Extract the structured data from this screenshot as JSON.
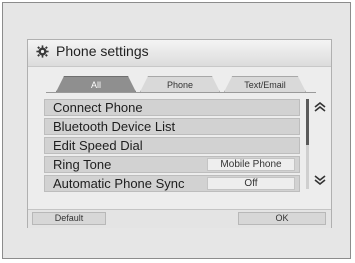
{
  "header": {
    "title": "Phone settings",
    "icon": "gear-icon"
  },
  "tabs": [
    {
      "label": "All",
      "active": true
    },
    {
      "label": "Phone",
      "active": false
    },
    {
      "label": "Text/Email",
      "active": false
    }
  ],
  "items": [
    {
      "label": "Connect Phone",
      "value": ""
    },
    {
      "label": "Bluetooth Device List",
      "value": ""
    },
    {
      "label": "Edit Speed Dial",
      "value": ""
    },
    {
      "label": "Ring Tone",
      "value": "Mobile Phone"
    },
    {
      "label": "Automatic Phone Sync",
      "value": "Off"
    }
  ],
  "footer": {
    "default_label": "Default",
    "ok_label": "OK"
  },
  "scroll": {
    "up_icon": "chevron-up-double-icon",
    "down_icon": "chevron-down-double-icon"
  }
}
